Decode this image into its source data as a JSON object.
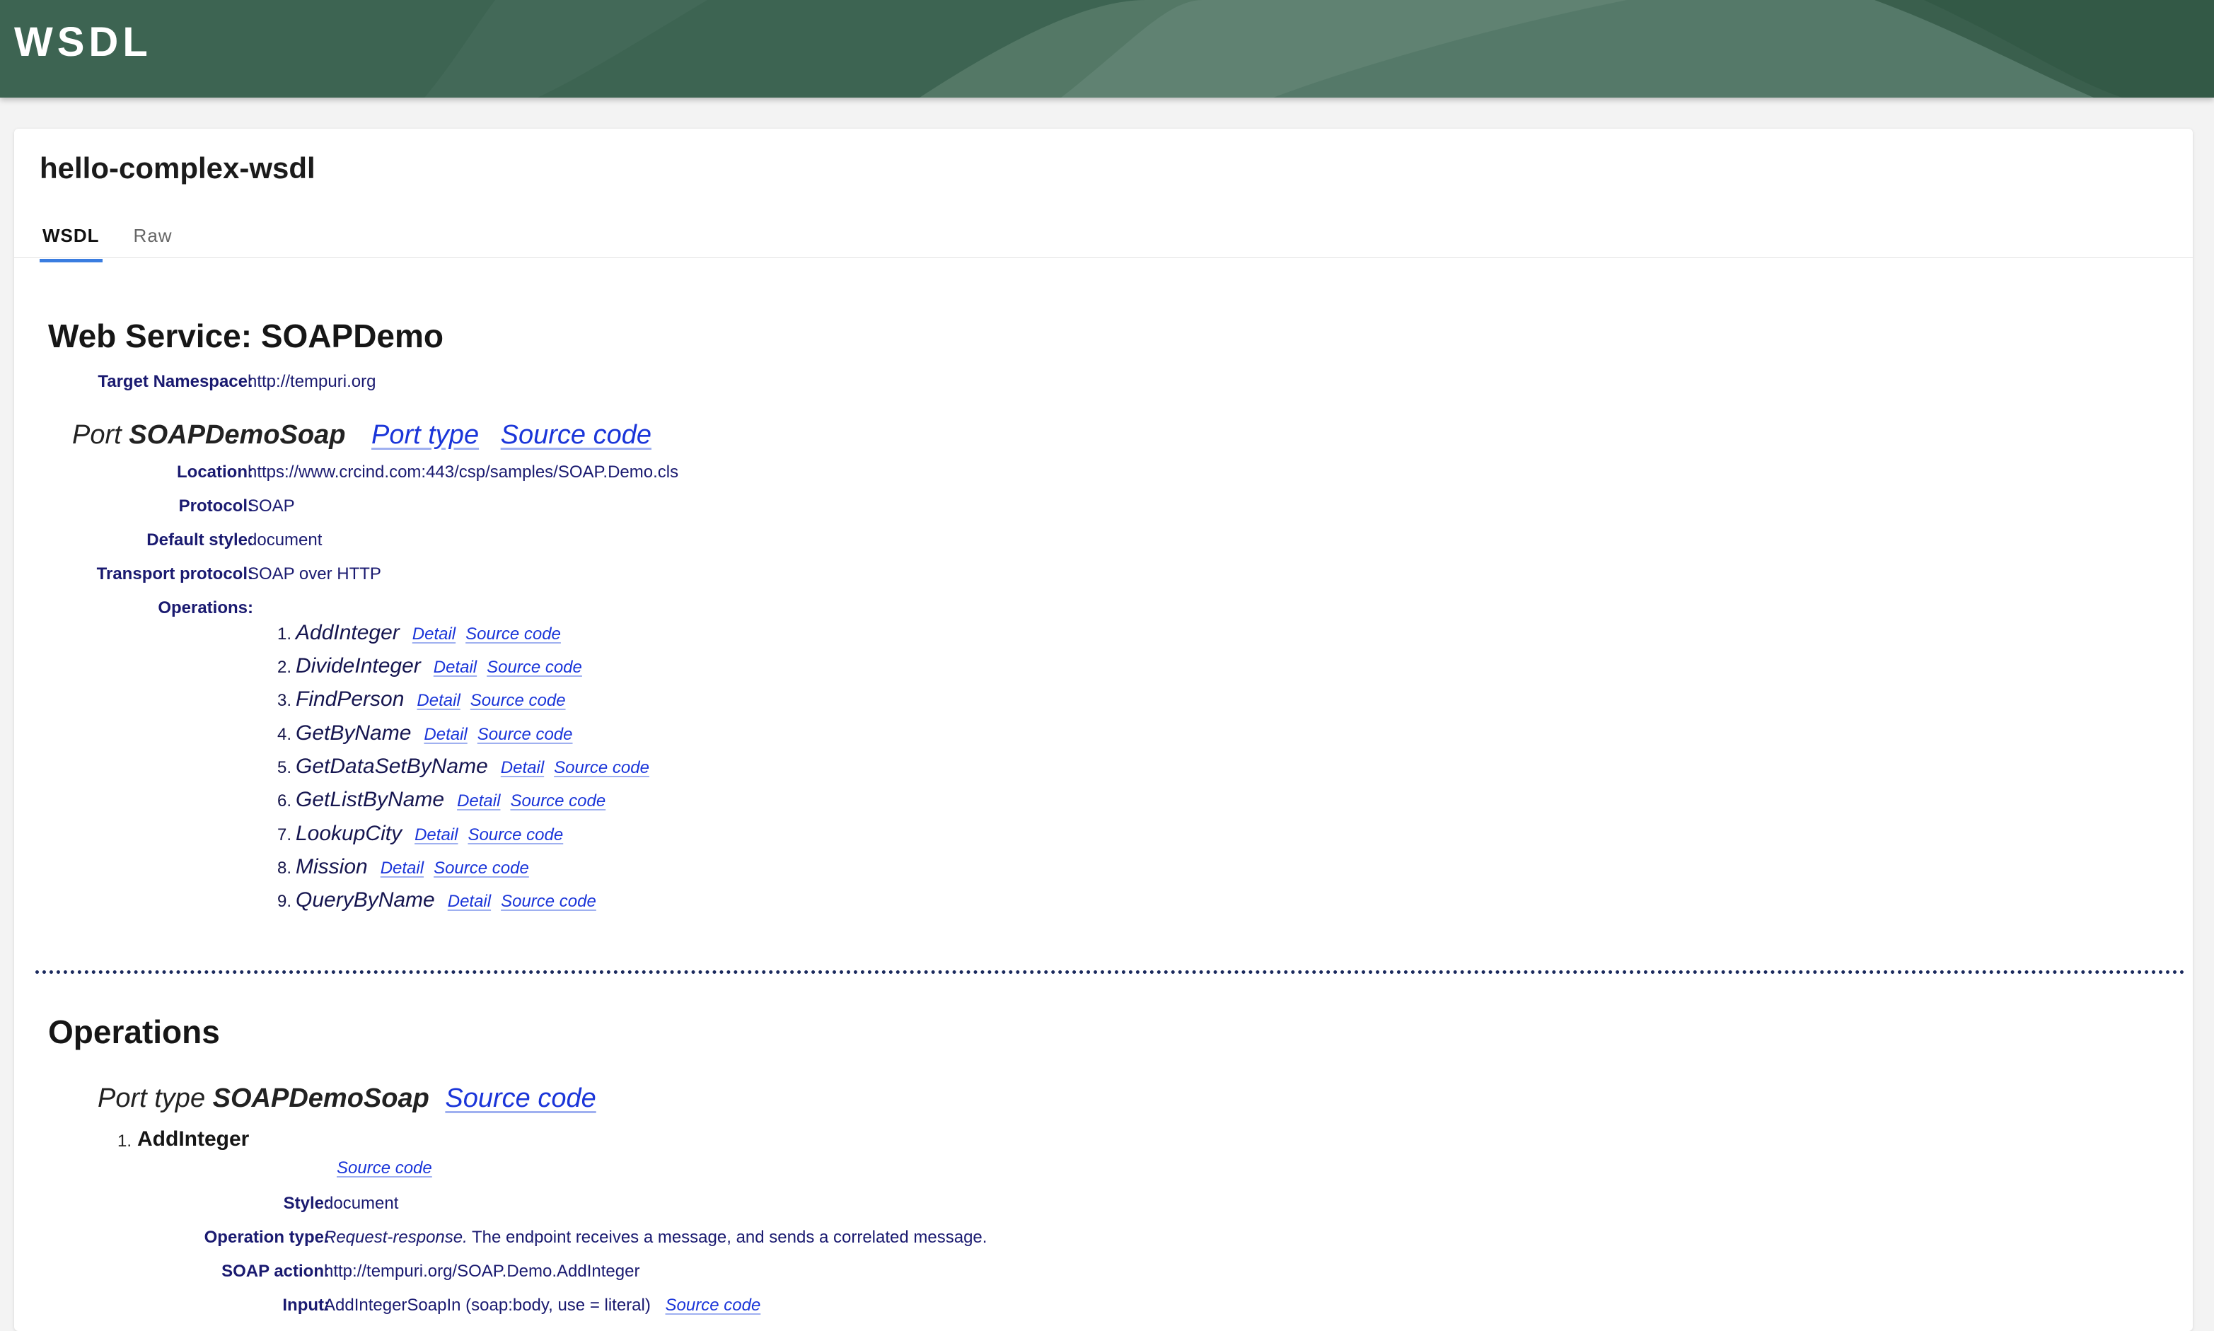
{
  "header": {
    "title": "WSDL"
  },
  "document": {
    "name": "hello-complex-wsdl",
    "tabs": [
      {
        "label": "WSDL"
      },
      {
        "label": "Raw"
      }
    ]
  },
  "service": {
    "heading": "Web Service: SOAPDemo",
    "namespace_label": "Target Namespace:",
    "namespace_value": "http://tempuri.org",
    "port": {
      "prefix": "Port",
      "name": "SOAPDemoSoap",
      "port_type_link": "Port type",
      "source_link": "Source code",
      "fields": [
        {
          "label": "Location:",
          "value": "https://www.crcind.com:443/csp/samples/SOAP.Demo.cls"
        },
        {
          "label": "Protocol:",
          "value": "SOAP"
        },
        {
          "label": "Default style:",
          "value": "document"
        },
        {
          "label": "Transport protocol:",
          "value": "SOAP over HTTP"
        }
      ],
      "operations_label": "Operations:",
      "operations": [
        {
          "num": "1.",
          "name": "AddInteger",
          "detail": "Detail",
          "source": "Source code"
        },
        {
          "num": "2.",
          "name": "DivideInteger",
          "detail": "Detail",
          "source": "Source code"
        },
        {
          "num": "3.",
          "name": "FindPerson",
          "detail": "Detail",
          "source": "Source code"
        },
        {
          "num": "4.",
          "name": "GetByName",
          "detail": "Detail",
          "source": "Source code"
        },
        {
          "num": "5.",
          "name": "GetDataSetByName",
          "detail": "Detail",
          "source": "Source code"
        },
        {
          "num": "6.",
          "name": "GetListByName",
          "detail": "Detail",
          "source": "Source code"
        },
        {
          "num": "7.",
          "name": "LookupCity",
          "detail": "Detail",
          "source": "Source code"
        },
        {
          "num": "8.",
          "name": "Mission",
          "detail": "Detail",
          "source": "Source code"
        },
        {
          "num": "9.",
          "name": "QueryByName",
          "detail": "Detail",
          "source": "Source code"
        }
      ]
    }
  },
  "operations_section": {
    "heading": "Operations",
    "port_type_prefix": "Port type",
    "port_type_name": "SOAPDemoSoap",
    "source_link": "Source code",
    "first_op": {
      "num": "1.",
      "name": "AddInteger",
      "source_link": "Source code",
      "style_label": "Style:",
      "style_value": "document",
      "optype_label": "Operation type:",
      "optype_em": "Request-response.",
      "optype_text": " The endpoint receives a message, and sends a correlated message.",
      "action_label": "SOAP action:",
      "action_value": "http://tempuri.org/SOAP.Demo.AddInteger",
      "input_label": "Input:",
      "input_value": "AddIntegerSoapIn (soap:body, use = literal)",
      "input_source_link": "Source code"
    }
  }
}
